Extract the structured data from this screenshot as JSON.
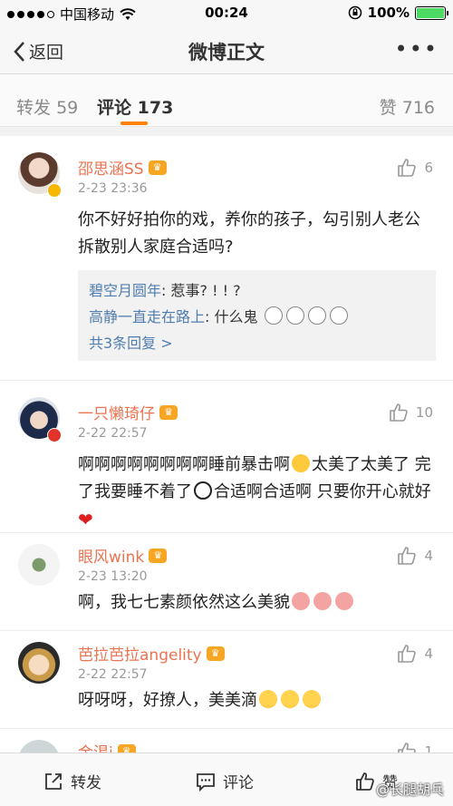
{
  "status_bar": {
    "carrier": "中国移动",
    "time": "00:24",
    "battery": "100%"
  },
  "nav": {
    "back_label": "返回",
    "title": "微博正文",
    "more": "•••"
  },
  "tabs": {
    "repost": {
      "label": "转发",
      "count": "59"
    },
    "comment": {
      "label": "评论",
      "count": "173"
    },
    "like": {
      "label": "赞",
      "count": "716"
    }
  },
  "comments": [
    {
      "name": "邵思涵SS",
      "time": "2-23 23:36",
      "likes": "6",
      "text": "你不好好拍你的戏，养你的孩子，勾引别人老公拆散别人家庭合适吗?",
      "replies": [
        {
          "user": "碧空月圆年",
          "text": "惹事? ! ! ?"
        },
        {
          "user": "高静一直走在路上",
          "text": "什么鬼"
        }
      ],
      "more_replies": "共3条回复 >"
    },
    {
      "name": "一只懒琦仔",
      "time": "2-22 22:57",
      "likes": "10",
      "text_1": "啊啊啊啊啊啊啊啊睡前暴击啊",
      "text_2": "太美了太美了 完了我要睡不着了",
      "text_3": "合适啊合适啊 只要你开心就好"
    },
    {
      "name": "眼风wink",
      "time": "2-23 13:20",
      "likes": "4",
      "text": "啊，我七七素颜依然这么美貌"
    },
    {
      "name": "芭拉芭拉angelity",
      "time": "2-22 22:57",
      "likes": "4",
      "text": "呀呀呀，好撩人，美美滴"
    },
    {
      "name": "金渴i",
      "likes": "1"
    }
  ],
  "bottom_bar": {
    "repost": "转发",
    "comment": "评论",
    "like": "赞"
  },
  "watermark": "@长腿胡乓",
  "colors": {
    "accent": "#ff8200",
    "name": "#eb7350",
    "link": "#507daf"
  }
}
